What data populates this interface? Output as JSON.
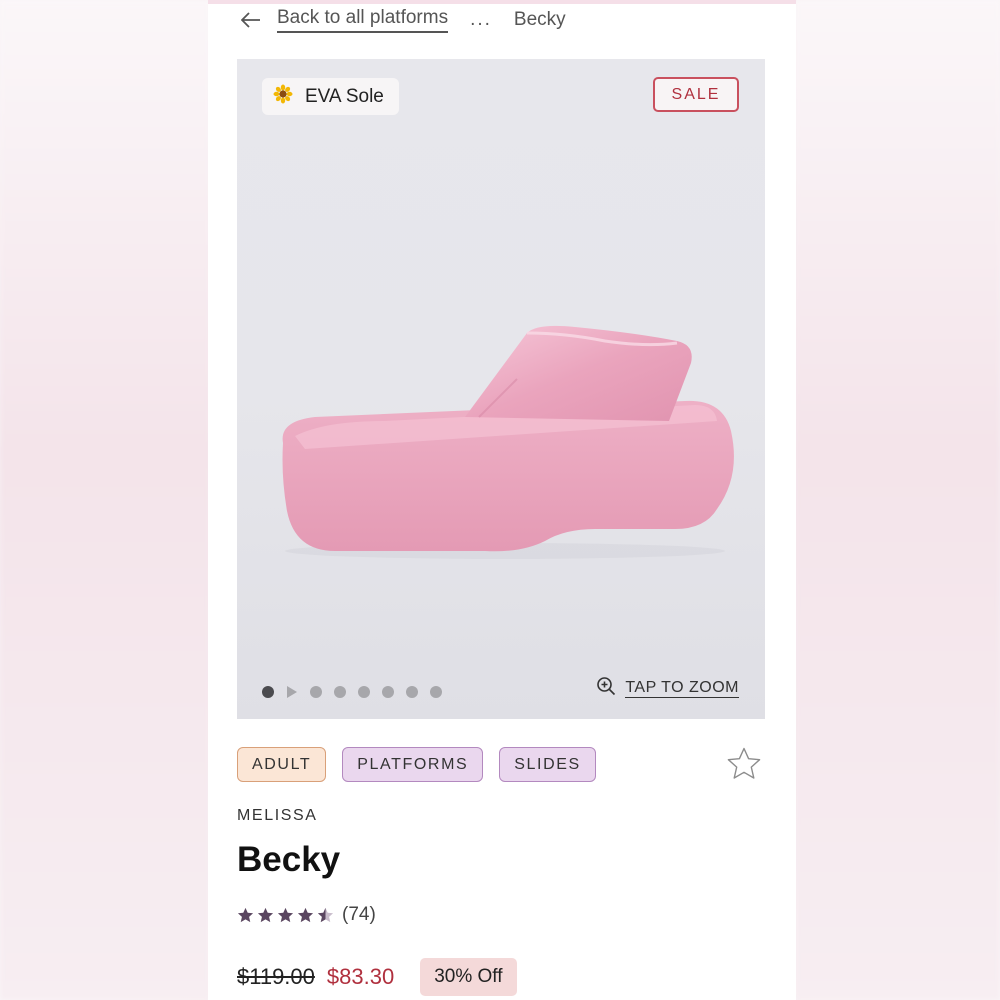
{
  "breadcrumb": {
    "back_label": "Back to all platforms",
    "separator": "...",
    "current": "Becky"
  },
  "gallery": {
    "feature_badge": "EVA Sole",
    "feature_icon": "sunflower-icon",
    "sale_badge": "SALE",
    "zoom_label": "TAP TO ZOOM",
    "slide_count": 8,
    "active_slide": 1
  },
  "tags": [
    "ADULT",
    "PLATFORMS",
    "SLIDES"
  ],
  "product": {
    "brand": "MELISSA",
    "name": "Becky",
    "rating": 4.5,
    "review_count": "(74)",
    "original_price": "$119.00",
    "sale_price": "$83.30",
    "discount": "30% Off"
  },
  "colors": {
    "sale_red": "#b0303e",
    "shoe_pink": "#eaa6bd",
    "rating_star": "#5a4660",
    "tag_purple_bg": "#ead7ee",
    "tag_adult_bg": "#fbe6d6"
  }
}
